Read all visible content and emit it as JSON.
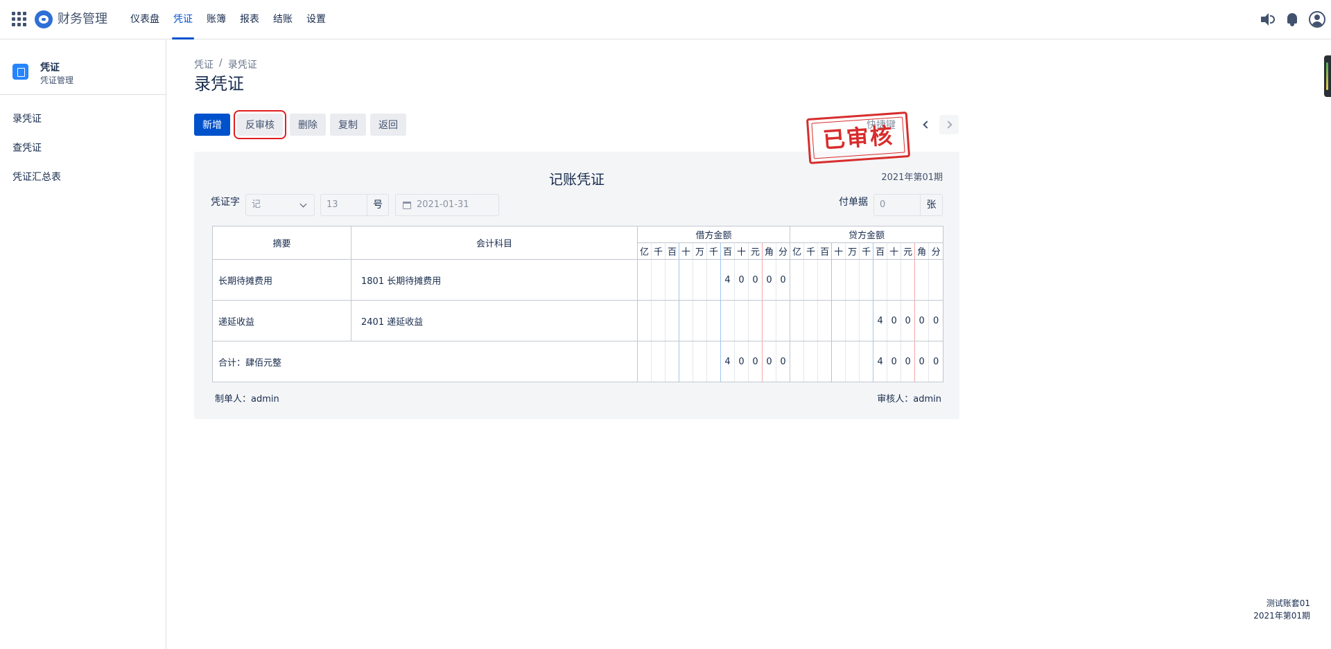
{
  "brand": {
    "name": "财务管理"
  },
  "nav": [
    {
      "label": "仪表盘"
    },
    {
      "label": "凭证"
    },
    {
      "label": "账簿"
    },
    {
      "label": "报表"
    },
    {
      "label": "结账"
    },
    {
      "label": "设置"
    }
  ],
  "nav_active_index": 1,
  "sidebar": {
    "title": "凭证",
    "subtitle": "凭证管理",
    "items": [
      {
        "label": "录凭证"
      },
      {
        "label": "查凭证"
      },
      {
        "label": "凭证汇总表"
      }
    ]
  },
  "breadcrumb": {
    "root": "凭证",
    "separator": "/",
    "current": "录凭证"
  },
  "page_title": "录凭证",
  "toolbar": {
    "add": "新增",
    "unaudit": "反审核",
    "delete": "删除",
    "copy": "复制",
    "back": "返回",
    "shortcut": "快捷键"
  },
  "stamp": "已审核",
  "voucher": {
    "title": "记账凭证",
    "period": "2021年第01期",
    "word_label": "凭证字",
    "word_value": "记",
    "number_value": "13",
    "number_unit": "号",
    "date_value": "2021-01-31",
    "attach_label": "付单据",
    "attach_value": "0",
    "attach_unit": "张",
    "headers": {
      "summary": "摘要",
      "account": "会计科目",
      "debit": "借方金额",
      "credit": "贷方金额"
    },
    "digit_units": [
      "亿",
      "千",
      "百",
      "十",
      "万",
      "千",
      "百",
      "十",
      "元",
      "角",
      "分"
    ],
    "rows": [
      {
        "summary": "长期待摊费用",
        "account": "1801 长期待摊费用",
        "debit": [
          "",
          "",
          "",
          "",
          "",
          "",
          "4",
          "0",
          "0",
          "0",
          "0"
        ],
        "credit": [
          "",
          "",
          "",
          "",
          "",
          "",
          "",
          "",
          "",
          "",
          ""
        ]
      },
      {
        "summary": "递延收益",
        "account": "2401 递延收益",
        "debit": [
          "",
          "",
          "",
          "",
          "",
          "",
          "",
          "",
          "",
          "",
          ""
        ],
        "credit": [
          "",
          "",
          "",
          "",
          "",
          "",
          "4",
          "0",
          "0",
          "0",
          "0"
        ]
      }
    ],
    "total": {
      "label": "合计：肆佰元整",
      "debit": [
        "",
        "",
        "",
        "",
        "",
        "",
        "4",
        "0",
        "0",
        "0",
        "0"
      ],
      "credit": [
        "",
        "",
        "",
        "",
        "",
        "",
        "4",
        "0",
        "0",
        "0",
        "0"
      ]
    },
    "maker": "制单人：admin",
    "auditor": "审核人：admin"
  },
  "footer": {
    "account_set": "测试账套01",
    "period": "2021年第01期"
  },
  "colors": {
    "primary": "#0052cc",
    "stamp": "#d82c2c",
    "highlight": "#e11d1d"
  }
}
